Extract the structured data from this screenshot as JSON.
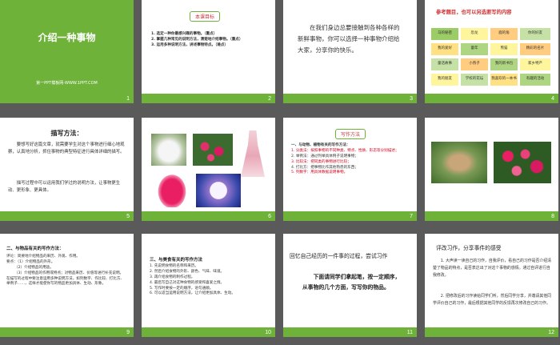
{
  "s1": {
    "title": "介绍一种事物",
    "subtitle": "第一PPT模板网-WWW.1PPT.COM",
    "num": "1"
  },
  "s2": {
    "tag": "本课目标",
    "items": [
      "1. 选定一种你最感兴趣的事物。（重点）",
      "2. 掌握几种常见的说明方法，清楚地介绍事物。（重点）",
      "3. 运用多种说明方法，讲述事物特点。（难点）"
    ],
    "num": "2"
  },
  "s3": {
    "text": "在我们身边总要接触到各种各样的新鲜事物，你可以选择一种事物介绍给大家，分享你的快乐。",
    "num": "3"
  },
  "s4": {
    "title": "参考题目，也可以另选要写的内容",
    "cells": [
      "马的秘密",
      "恐龙",
      "鹿的角",
      "你的好友",
      "我的爱好",
      "童年",
      "熊猫",
      "精彩的名片",
      "童话故事",
      "小燕子",
      "我的新书包",
      "家乡特产",
      "我的朋友",
      "学校的花坛",
      "我喜欢的一本书",
      "有趣的活动"
    ],
    "num": "4"
  },
  "s5": {
    "title": "描写方法：",
    "p1": "要想写好这篇文章，就需要学生对这个事物进行细心地观察，认真地分析，抓住事物的典型特征进行具体详细的描写。",
    "p2": "描写过程中可以运用我们学过的说明方法，让事物更生动、更形象、更具体。",
    "num": "5"
  },
  "s6": {
    "num": "6"
  },
  "s7": {
    "tag": "写作方法",
    "lines": [
      "一、与动物、植物有关的写作方法：",
      "1. 分类法：按照事物的不同种类、特点、性质、形态等分别描述；",
      "2. 举例法：通过列举具体例子说明事物；",
      "3. 比较法：把同类的事物进行比较；",
      "4. 打比方：把事物比作其他熟悉的东西；",
      "5. 列数字：用具体数据说明事物。"
    ],
    "num": "7"
  },
  "s8": {
    "num": "8"
  },
  "s9": {
    "title": "二、与物品有关的写作方法：",
    "lines": [
      "评论：简要地介绍物品的来历、外观、作用。",
      "要点：（1）介绍物品的外形。",
      "（2）介绍物品的用途。",
      "（3）介绍物品的作用或特点；对物品来历、价值等进行补充说明。",
      "在描写的过程中要注意运用多种说明方法，如列数字、作比较、打比方、举例子……，这样才能使你写的物品更加具体、生动、形象。"
    ],
    "num": "9"
  },
  "s10": {
    "title": "三、与美食有关的写作方法",
    "lines": [
      "1. 先说明食物的名称和来历。",
      "2. 然后介绍食物的外形、颜色、气味、味道。",
      "3. 再介绍食物的制作过程。",
      "4. 最后写自己对这种食物的感受和喜爱之情。",
      "5. 写作时要按一定的顺序，语句通顺。",
      "6. 可以适当运用说明方法，让介绍更加具体、生动。"
    ],
    "num": "10"
  },
  "s11": {
    "title": "回忆自己经历的一件事的过程，尝试习作",
    "text": "下面请同学们拿起笔，按一定顺序，从事物的几个方面，写写你的物品。",
    "num": "11"
  },
  "s12": {
    "title": "评改习作，分享事件的感受",
    "p1": "1. 大声读一读自己的习作，自我评价，看自己的习作是否介绍清楚了物品的特点，是否表达出了对这个事物的感情。通过自评进行自我修改。",
    "p2": "2. 把修改后的习作读给同学们听，然后同学分享，并邀请其他同学评价自己的习作，最后根据其他同学的反馈再次修改自己的习作。",
    "num": "12"
  },
  "colors": {
    "green": "#6fb23a",
    "red": "#d0021b",
    "orange": "#f0a000"
  }
}
